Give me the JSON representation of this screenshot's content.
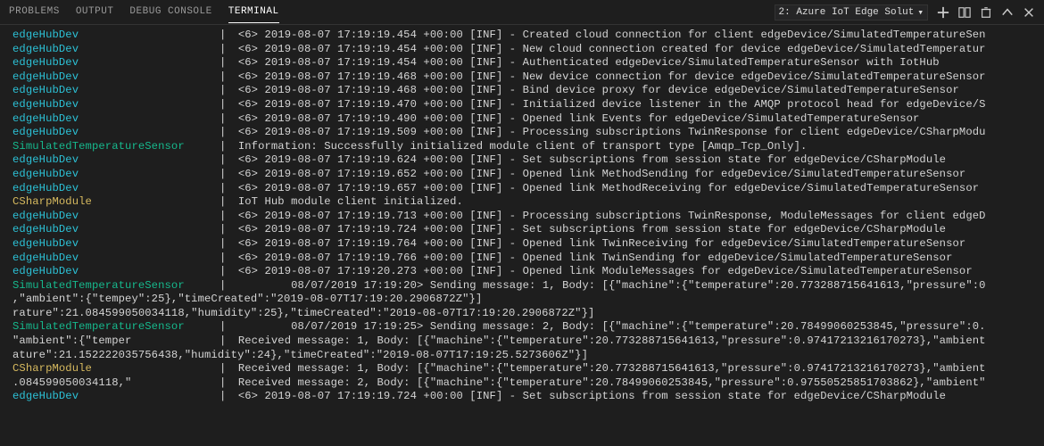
{
  "tabs": {
    "problems": "PROBLEMS",
    "output": "OUTPUT",
    "debug": "DEBUG CONSOLE",
    "terminal": "TERMINAL"
  },
  "dropdown": "2: Azure IoT Edge Solut",
  "lines": [
    {
      "src": "edgeHubDev",
      "cls": "cyan",
      "msg": "<6> 2019-08-07 17:19:19.454 +00:00 [INF] - Created cloud connection for client edgeDevice/SimulatedTemperatureSen"
    },
    {
      "src": "edgeHubDev",
      "cls": "cyan",
      "msg": "<6> 2019-08-07 17:19:19.454 +00:00 [INF] - New cloud connection created for device edgeDevice/SimulatedTemperatur"
    },
    {
      "src": "edgeHubDev",
      "cls": "cyan",
      "msg": "<6> 2019-08-07 17:19:19.454 +00:00 [INF] - Authenticated edgeDevice/SimulatedTemperatureSensor with IotHub"
    },
    {
      "src": "edgeHubDev",
      "cls": "cyan",
      "msg": "<6> 2019-08-07 17:19:19.468 +00:00 [INF] - New device connection for device edgeDevice/SimulatedTemperatureSensor"
    },
    {
      "src": "edgeHubDev",
      "cls": "cyan",
      "msg": "<6> 2019-08-07 17:19:19.468 +00:00 [INF] - Bind device proxy for device edgeDevice/SimulatedTemperatureSensor"
    },
    {
      "src": "edgeHubDev",
      "cls": "cyan",
      "msg": "<6> 2019-08-07 17:19:19.470 +00:00 [INF] - Initialized device listener in the AMQP protocol head for edgeDevice/S"
    },
    {
      "src": "edgeHubDev",
      "cls": "cyan",
      "msg": "<6> 2019-08-07 17:19:19.490 +00:00 [INF] - Opened link Events for edgeDevice/SimulatedTemperatureSensor"
    },
    {
      "src": "edgeHubDev",
      "cls": "cyan",
      "msg": "<6> 2019-08-07 17:19:19.509 +00:00 [INF] - Processing subscriptions TwinResponse for client edgeDevice/CSharpModu"
    },
    {
      "src": "SimulatedTemperatureSensor",
      "cls": "green",
      "msg": "Information: Successfully initialized module client of transport type [Amqp_Tcp_Only]."
    },
    {
      "src": "edgeHubDev",
      "cls": "cyan",
      "msg": "<6> 2019-08-07 17:19:19.624 +00:00 [INF] - Set subscriptions from session state for edgeDevice/CSharpModule"
    },
    {
      "src": "edgeHubDev",
      "cls": "cyan",
      "msg": "<6> 2019-08-07 17:19:19.652 +00:00 [INF] - Opened link MethodSending for edgeDevice/SimulatedTemperatureSensor"
    },
    {
      "src": "edgeHubDev",
      "cls": "cyan",
      "msg": "<6> 2019-08-07 17:19:19.657 +00:00 [INF] - Opened link MethodReceiving for edgeDevice/SimulatedTemperatureSensor"
    },
    {
      "src": "CSharpModule",
      "cls": "yellow",
      "msg": "IoT Hub module client initialized."
    },
    {
      "src": "edgeHubDev",
      "cls": "cyan",
      "msg": "<6> 2019-08-07 17:19:19.713 +00:00 [INF] - Processing subscriptions TwinResponse, ModuleMessages for client edgeD"
    },
    {
      "src": "edgeHubDev",
      "cls": "cyan",
      "msg": "<6> 2019-08-07 17:19:19.724 +00:00 [INF] - Set subscriptions from session state for edgeDevice/CSharpModule"
    },
    {
      "src": "edgeHubDev",
      "cls": "cyan",
      "msg": "<6> 2019-08-07 17:19:19.764 +00:00 [INF] - Opened link TwinReceiving for edgeDevice/SimulatedTemperatureSensor"
    },
    {
      "src": "edgeHubDev",
      "cls": "cyan",
      "msg": "<6> 2019-08-07 17:19:19.766 +00:00 [INF] - Opened link TwinSending for edgeDevice/SimulatedTemperatureSensor"
    },
    {
      "src": "edgeHubDev",
      "cls": "cyan",
      "msg": "<6> 2019-08-07 17:19:20.273 +00:00 [INF] - Opened link ModuleMessages for edgeDevice/SimulatedTemperatureSensor"
    },
    {
      "src": "SimulatedTemperatureSensor",
      "cls": "green",
      "msg": "        08/07/2019 17:19:20> Sending message: 1, Body: [{\"machine\":{\"temperature\":20.773288715641613,\"pressure\":0"
    },
    {
      "wrap": ",\"ambient\":{\"tempey\":25},\"timeCreated\":\"2019-08-07T17:19:20.2906872Z\"}]"
    },
    {
      "wrap": "rature\":21.084599050034118,\"humidity\":25},\"timeCreated\":\"2019-08-07T17:19:20.2906872Z\"}]"
    },
    {
      "src": "SimulatedTemperatureSensor",
      "cls": "green",
      "msg": "        08/07/2019 17:19:25> Sending message: 2, Body: [{\"machine\":{\"temperature\":20.78499060253845,\"pressure\":0."
    },
    {
      "src": "\"ambient\":{\"temper",
      "cls": "gray",
      "msg": "Received message: 1, Body: [{\"machine\":{\"temperature\":20.773288715641613,\"pressure\":0.97417213216170273},\"ambient"
    },
    {
      "wrap": "ature\":21.152222035756438,\"humidity\":24},\"timeCreated\":\"2019-08-07T17:19:25.5273606Z\"}]"
    },
    {
      "src": "CSharpModule",
      "cls": "yellow",
      "msg": "Received message: 1, Body: [{\"machine\":{\"temperature\":20.773288715641613,\"pressure\":0.97417213216170273},\"ambient"
    },
    {
      "src": ".084599050034118,\"",
      "cls": "gray",
      "msg": "Received message: 2, Body: [{\"machine\":{\"temperature\":20.78499060253845,\"pressure\":0.97550525851703862},\"ambient\""
    },
    {
      "src": "edgeHubDev",
      "cls": "cyan",
      "msg": "<6> 2019-08-07 17:19:19.724 +00:00 [INF] - Set subscriptions from session state for edgeDevice/CSharpModule"
    }
  ]
}
